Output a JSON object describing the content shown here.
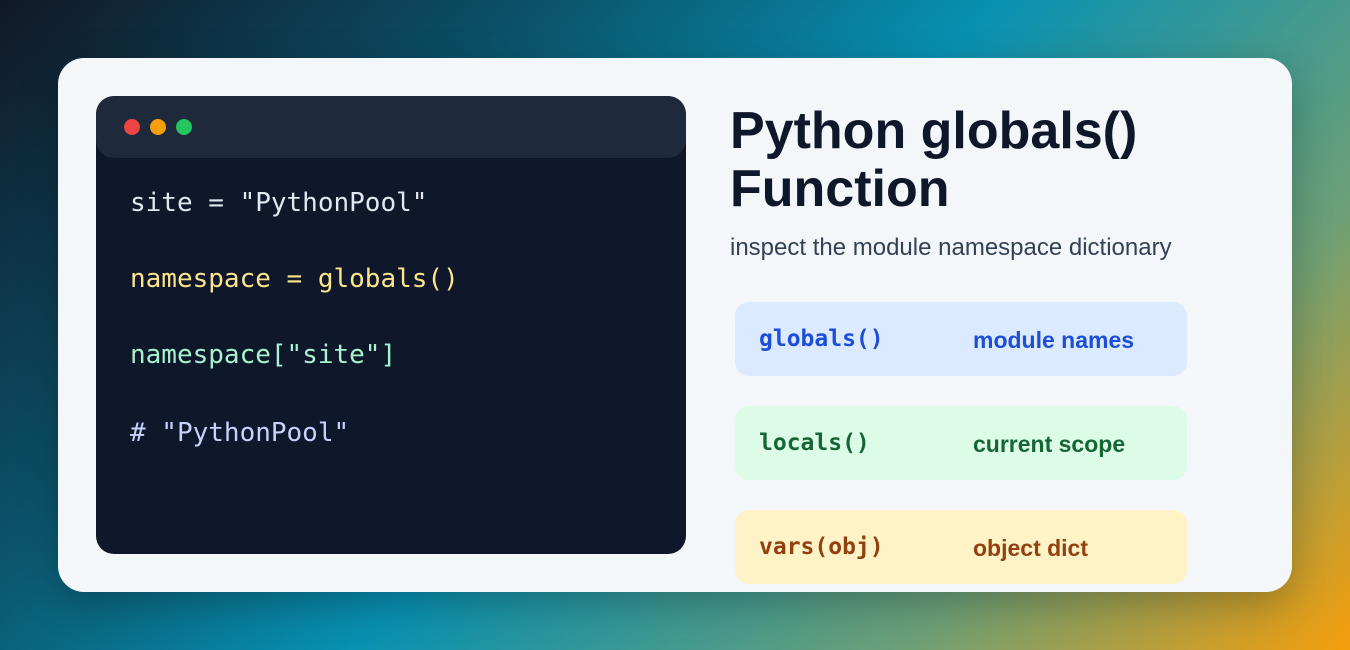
{
  "heading": {
    "title_line1": "Python globals()",
    "title_line2": "Function",
    "subtitle": "inspect the module namespace dictionary"
  },
  "terminal": {
    "dot_colors": [
      "#ef4444",
      "#f59e0b",
      "#22c55e"
    ],
    "lines": [
      {
        "text": "site = \"PythonPool\"",
        "color": "#e2e8f0"
      },
      {
        "text": "namespace = globals()",
        "color": "#fde68a"
      },
      {
        "text": "namespace[\"site\"]",
        "color": "#a7f3d0"
      },
      {
        "text": "# \"PythonPool\"",
        "color": "#c7d2fe"
      }
    ]
  },
  "functions": [
    {
      "name": "globals()",
      "desc": "module names",
      "bg": "#dbeafe",
      "fg": "#1d4ed8"
    },
    {
      "name": "locals()",
      "desc": "current scope",
      "bg": "#dcfce7",
      "fg": "#166534"
    },
    {
      "name": "vars(obj)",
      "desc": "object dict",
      "bg": "#fef3c7",
      "fg": "#92400e"
    }
  ]
}
